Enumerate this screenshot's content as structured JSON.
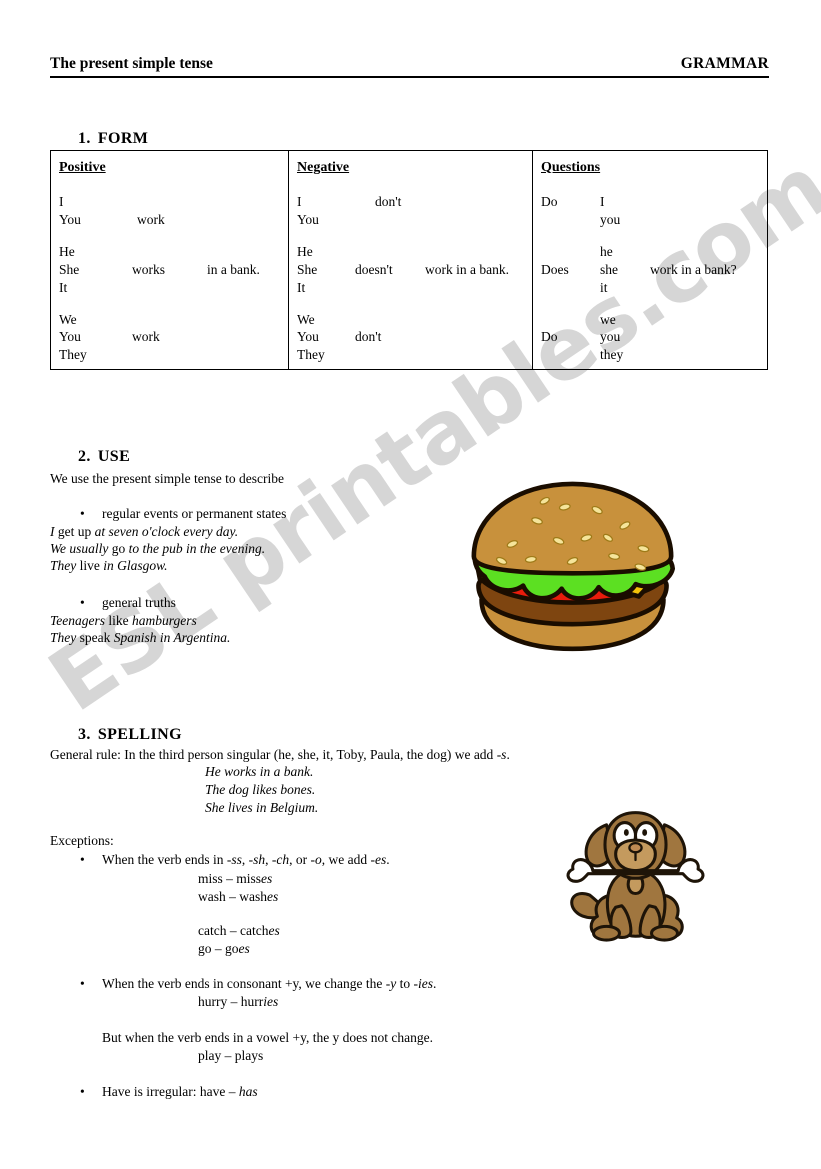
{
  "header": {
    "title": "The present simple tense",
    "right_label": "GRAMMAR"
  },
  "sections": {
    "form": {
      "num": "1.",
      "label": "FORM"
    },
    "use": {
      "num": "2.",
      "label": "USE"
    },
    "spelling": {
      "num": "3.",
      "label": "SPELLING"
    }
  },
  "form_table": {
    "columns": [
      {
        "title": "Positive",
        "rows": [
          {
            "subject": "I",
            "aux": "",
            "verb": "",
            "rest": ""
          },
          {
            "subject": "You",
            "aux": "work",
            "verb": "",
            "rest": ""
          },
          {
            "subject": "He",
            "aux": "",
            "verb": "",
            "rest": ""
          },
          {
            "subject": "She",
            "aux": "works",
            "verb": "",
            "rest": "in a bank."
          },
          {
            "subject": "It",
            "aux": "",
            "verb": "",
            "rest": ""
          },
          {
            "subject": "We",
            "aux": "",
            "verb": "",
            "rest": ""
          },
          {
            "subject": "You",
            "aux": "work",
            "verb": "",
            "rest": ""
          },
          {
            "subject": "They",
            "aux": "",
            "verb": "",
            "rest": ""
          }
        ]
      },
      {
        "title": "Negative",
        "rows": [
          {
            "subject": "I",
            "aux": "don't",
            "verb": "",
            "rest": ""
          },
          {
            "subject": "You",
            "aux": "",
            "verb": "",
            "rest": ""
          },
          {
            "subject": "He",
            "aux": "",
            "verb": "",
            "rest": ""
          },
          {
            "subject": "She",
            "aux": "doesn't",
            "verb": "",
            "rest": "work in a bank."
          },
          {
            "subject": "It",
            "aux": "",
            "verb": "",
            "rest": ""
          },
          {
            "subject": "We",
            "aux": "",
            "verb": "",
            "rest": ""
          },
          {
            "subject": "You",
            "aux": "don't",
            "verb": "",
            "rest": ""
          },
          {
            "subject": "They",
            "aux": "",
            "verb": "",
            "rest": ""
          }
        ]
      },
      {
        "title": "Questions",
        "rows": [
          {
            "aux": "Do",
            "subject": "I",
            "rest": ""
          },
          {
            "aux": "",
            "subject": "you",
            "rest": ""
          },
          {
            "aux": "",
            "subject": "he",
            "rest": ""
          },
          {
            "aux": "Does",
            "subject": "she",
            "rest": "work in a bank?"
          },
          {
            "aux": "",
            "subject": "it",
            "rest": ""
          },
          {
            "aux": "",
            "subject": "we",
            "rest": ""
          },
          {
            "aux": "Do",
            "subject": "you",
            "rest": ""
          },
          {
            "aux": "",
            "subject": "they",
            "rest": ""
          }
        ]
      }
    ]
  },
  "use": {
    "intro": "We use the present simple tense to describe",
    "bullet1": "regular events or permanent states",
    "examples1": [
      {
        "a": "I",
        "b": " get up ",
        "c": "at seven o'clock every day."
      },
      {
        "a": "We usually",
        "b": " go ",
        "c": "to the pub in the evening."
      },
      {
        "a": "They",
        "b": " live ",
        "c": "in Glasgow."
      }
    ],
    "bullet2": "general truths",
    "examples2": [
      {
        "a": "Teenagers",
        "b": " like ",
        "c": "hamburgers"
      },
      {
        "a": "They",
        "b": " speak ",
        "c": "Spanish in Argentina."
      }
    ]
  },
  "spelling": {
    "general_rule_pre": "General rule: In the third person singular (he, she, it, Toby, Paula, the dog) we add ",
    "general_rule_suffix": "-s",
    "general_rule_post": ".",
    "rule_examples": [
      "He works in a bank.",
      "The dog likes bones.",
      "She lives in Belgium."
    ],
    "exceptions_label": "Exceptions:",
    "exception1_pre": "When the verb ends in ",
    "exception1_s1": "-ss",
    "exception1_m1": ", ",
    "exception1_s2": "-sh",
    "exception1_m2": ", ",
    "exception1_s3": "-ch",
    "exception1_m3": ", or ",
    "exception1_s4": "-o",
    "exception1_m4": ", we add ",
    "exception1_s5": "-es",
    "exception1_end": ".",
    "exception1_examples_a": [
      {
        "base": "miss – miss",
        "suffix": "es"
      },
      {
        "base": "wash – wash",
        "suffix": "es"
      }
    ],
    "exception1_examples_b": [
      {
        "base": "catch – catch",
        "suffix": "es"
      },
      {
        "base": "go – go",
        "suffix": "es"
      }
    ],
    "exception2_pre": "When the verb ends in consonant +y, we change the ",
    "exception2_y": "-y",
    "exception2_mid": " to ",
    "exception2_ies": "-ies",
    "exception2_end": ".",
    "exception2_example_base": "hurry – hurr",
    "exception2_example_suffix": "ies",
    "exception2_note": "But when the verb ends in a vowel +y, the y does not change.",
    "exception2_note_example_base": "play – play",
    "exception2_note_example_suffix": "s",
    "exception3_pre": "Have is irregular: have – ",
    "exception3_has": "has"
  },
  "illustrations": {
    "hamburger": {
      "name": "hamburger-illustration",
      "bun_top": "#C8913C",
      "bun_bottom": "#C8913C",
      "patty": "#7E4510",
      "lettuce": "#5CE022",
      "tomato": "#E81C0C",
      "cheese": "#F2C20A",
      "seed": "#F5E49A",
      "outline": "#1A0D00"
    },
    "dog": {
      "name": "dog-illustration",
      "body": "#A0763F",
      "muzzle": "#C49A5E",
      "eye_patch": "#FFFFFF",
      "bone": "#FFFFFF",
      "outline": "#1E1408"
    }
  },
  "watermark": {
    "text": "ESL printables.com",
    "color": "#C9C9C9"
  }
}
